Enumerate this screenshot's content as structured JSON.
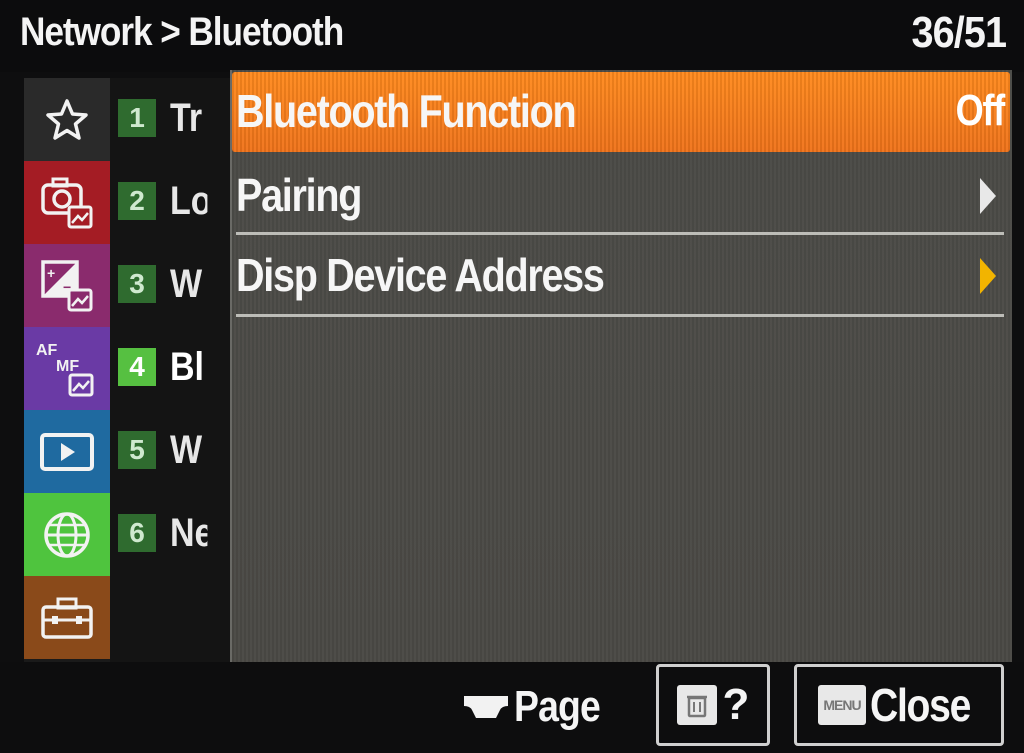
{
  "header": {
    "breadcrumb": "Network > Bluetooth",
    "page_counter": "36/51"
  },
  "categories": [
    {
      "name": "my-menu",
      "icon": "star-icon",
      "color": "#2a2a2a"
    },
    {
      "name": "shooting",
      "icon": "camera-icon",
      "color": "#a41c24"
    },
    {
      "name": "exposure-color",
      "icon": "exposure-icon",
      "color": "#8a2b6d"
    },
    {
      "name": "focus",
      "icon": "af-mf-icon",
      "color": "#6a3aa5"
    },
    {
      "name": "playback",
      "icon": "playback-icon",
      "color": "#1f6aa0"
    },
    {
      "name": "network",
      "icon": "globe-icon",
      "color": "#4fc43e",
      "active": true
    },
    {
      "name": "setup",
      "icon": "toolbox-icon",
      "color": "#8a4a1a"
    }
  ],
  "pages": [
    {
      "num": "1",
      "label": "Tr"
    },
    {
      "num": "2",
      "label": "Lo"
    },
    {
      "num": "3",
      "label": "W"
    },
    {
      "num": "4",
      "label": "Bl",
      "active": true
    },
    {
      "num": "5",
      "label": "W"
    },
    {
      "num": "6",
      "label": "Ne"
    }
  ],
  "menu": [
    {
      "label": "Bluetooth Function",
      "value": "Off",
      "selected": true
    },
    {
      "label": "Pairing"
    },
    {
      "label": "Disp Device Address"
    }
  ],
  "footer": {
    "page_label": "Page",
    "help_label": "?",
    "menu_key_label": "MENU",
    "close_label": "Close"
  },
  "colors": {
    "selected_row": "#f07a1b",
    "active_page_badge": "#56c041",
    "arrow_highlight": "#f2b400"
  }
}
